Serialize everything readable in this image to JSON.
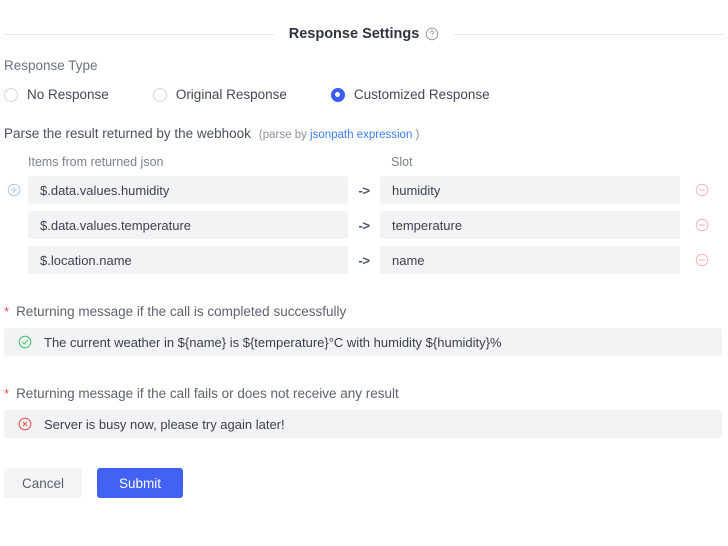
{
  "section": {
    "title": "Response Settings",
    "help_icon": "question-circle-icon"
  },
  "response_type": {
    "label": "Response Type",
    "options": [
      {
        "label": "No Response",
        "selected": false
      },
      {
        "label": "Original Response",
        "selected": false
      },
      {
        "label": "Customized Response",
        "selected": true
      }
    ]
  },
  "parse": {
    "text": "Parse the result returned by the webhook",
    "hint_prefix": "(parse by",
    "link": "jsonpath expression",
    "hint_suffix": ")"
  },
  "mapping": {
    "headers": {
      "left": "Items from returned json",
      "right": "Slot"
    },
    "arrow": "->",
    "add_icon": "plus-circle-icon",
    "remove_icon": "minus-circle-icon",
    "rows": [
      {
        "item": "$.data.values.humidity",
        "slot": "humidity"
      },
      {
        "item": "$.data.values.temperature",
        "slot": "temperature"
      },
      {
        "item": "$.location.name",
        "slot": "name"
      }
    ]
  },
  "success_message": {
    "required_marker": "*",
    "label": "Returning message if the call is completed successfully",
    "icon": "check-circle-icon",
    "value": "The current weather in ${name} is ${temperature}°C with humidity ${humidity}%"
  },
  "error_message": {
    "required_marker": "*",
    "label": "Returning message if the call fails or does not receive any result",
    "icon": "x-circle-icon",
    "value": "Server is busy now, please try again later!"
  },
  "footer": {
    "cancel_label": "Cancel",
    "submit_label": "Submit"
  },
  "colors": {
    "accent": "#4261f5",
    "radio_selected": "#3c5ef5",
    "link": "#3c7df5",
    "required": "#f04b4b",
    "success": "#3fbf6a",
    "error": "#ef4a4a",
    "field_bg": "#f2f3f5"
  }
}
